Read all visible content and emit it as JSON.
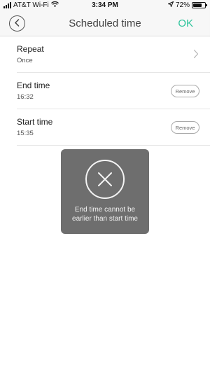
{
  "status_bar": {
    "carrier": "AT&T Wi-Fi",
    "time": "3:34 PM",
    "battery": "72%",
    "battery_level": 0.72,
    "icons": [
      "signal-icon",
      "wifi-icon",
      "location-icon",
      "battery-icon"
    ]
  },
  "nav": {
    "title": "Scheduled time",
    "confirm_label": "OK",
    "back_icon": "chevron-left-icon",
    "accent_color": "#2ec49c"
  },
  "rows": [
    {
      "label": "Repeat",
      "value": "Once",
      "action_icon": "chevron-right-icon"
    },
    {
      "label": "End time",
      "value": "16:32",
      "action_label": "Remove"
    },
    {
      "label": "Start time",
      "value": "15:35",
      "action_label": "Remove"
    }
  ],
  "toast": {
    "icon": "close-circle-icon",
    "message_line1": "End time cannot be",
    "message_line2": "earlier than start time"
  }
}
